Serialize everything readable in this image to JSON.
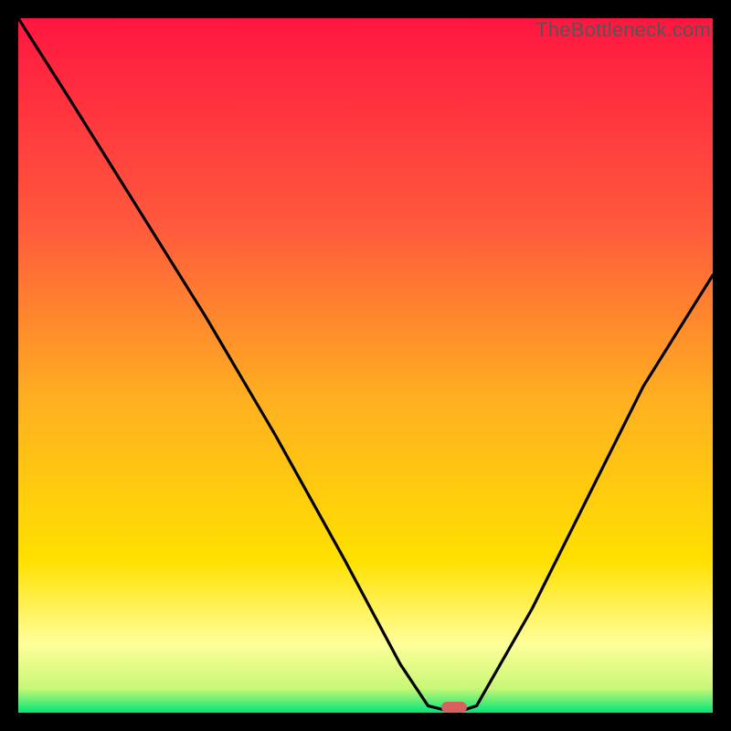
{
  "watermark": "TheBottleneck.com",
  "colors": {
    "black": "#000000",
    "curve": "#000000",
    "marker": "#d8605f",
    "gradient_top": "#ff1640",
    "gradient_mid": "#ffd500",
    "gradient_bottom_yellow": "#ffff99",
    "gradient_green": "#00e676"
  },
  "marker": {
    "x_frac": 0.627,
    "y_frac": 0.992
  },
  "chart_data": {
    "type": "line",
    "title": "",
    "xlabel": "",
    "ylabel": "",
    "xlim": [
      0,
      1
    ],
    "ylim": [
      0,
      1
    ],
    "x": [
      0.0,
      0.07,
      0.17,
      0.27,
      0.37,
      0.47,
      0.55,
      0.59,
      0.63,
      0.66,
      0.74,
      0.82,
      0.9,
      1.0
    ],
    "y": [
      1.0,
      0.89,
      0.73,
      0.57,
      0.4,
      0.22,
      0.07,
      0.01,
      0.0,
      0.01,
      0.15,
      0.31,
      0.47,
      0.63
    ],
    "background_gradient": [
      {
        "stop": 0.0,
        "color": "#ff1640"
      },
      {
        "stop": 0.3,
        "color": "#ff5a3c"
      },
      {
        "stop": 0.55,
        "color": "#ffb020"
      },
      {
        "stop": 0.78,
        "color": "#ffe000"
      },
      {
        "stop": 0.9,
        "color": "#ffff99"
      },
      {
        "stop": 0.965,
        "color": "#c8f776"
      },
      {
        "stop": 1.0,
        "color": "#00e676"
      }
    ],
    "marker": {
      "x": 0.627,
      "y": 0.0,
      "color": "#d8605f"
    }
  }
}
